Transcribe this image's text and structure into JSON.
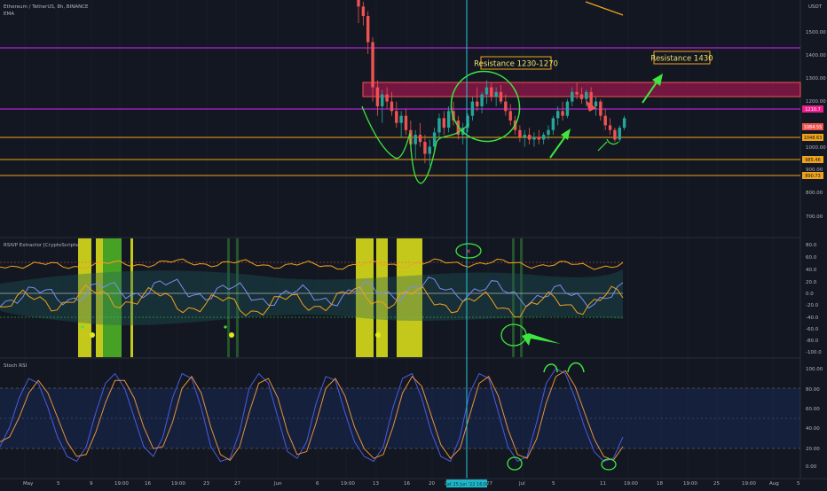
{
  "header": {
    "symbol_line": "Ethereum / TetherUS, 8h, BINANCE",
    "ema_label": "EMA",
    "quote_currency": "USDT"
  },
  "colors": {
    "background": "#131722",
    "grid": "#1e2230",
    "up": "#26a69a",
    "down": "#ef5350",
    "magenta": "#b321d6",
    "orange": "#f0a31a",
    "green_annot": "#3ee63e",
    "resistance_zone": "#c2185b",
    "cyan": "#29c4d6",
    "blue_line": "#5b6fd9",
    "stoch_k": "#4a5be0",
    "stoch_d": "#e8913a",
    "yellow_bar": "#e4e81a",
    "green_bar": "#55c425"
  },
  "annotations": {
    "res1": "Resistance 1230-1270",
    "res2": "Resistance 1430"
  },
  "price_axis": {
    "labels": [
      "1500.00",
      "1400.00",
      "1300.00",
      "1200.00",
      "1000.00",
      "900.00",
      "800.00",
      "700.00"
    ],
    "tags": [
      "1210.7",
      "1084.55",
      "1048.63",
      "985.46",
      "890.73"
    ]
  },
  "rsivp": {
    "title": "RSIVP Extractor [CryptoScripts]",
    "labels": [
      "80.0",
      "60.0",
      "40.0",
      "20.0",
      "0.0",
      "-20.0",
      "-40.0",
      "-60.0",
      "-80.0",
      "-100.0"
    ]
  },
  "stoch": {
    "title": "Stoch RSI",
    "labels": [
      "100.00",
      "80.00",
      "60.00",
      "40.00",
      "20.00",
      "0.00"
    ]
  },
  "time_axis": {
    "labels": [
      "May",
      "5",
      "9",
      "19:00",
      "16",
      "19:00",
      "23",
      "27",
      "Jun",
      "6",
      "19:00",
      "13",
      "16",
      "20",
      "23",
      "27",
      "Jul",
      "5",
      "11",
      "19:00",
      "18",
      "19:00",
      "25",
      "19:00",
      "Aug",
      "5"
    ],
    "cursor_date": "Sat 25 Jun '22 16:00"
  },
  "chart_data": {
    "type": "candlestick",
    "title": "Ethereum / TetherUS, 8h, BINANCE",
    "ylim": [
      650,
      1620
    ],
    "price_levels": [
      1450,
      1212,
      1047,
      988,
      890
    ],
    "resistance_zone": [
      1230,
      1290
    ],
    "candles_ohlc": [
      [
        1660,
        1700,
        1530,
        1600
      ],
      [
        1600,
        1620,
        1520,
        1560
      ],
      [
        1560,
        1580,
        1400,
        1450
      ],
      [
        1450,
        1470,
        1200,
        1260
      ],
      [
        1260,
        1290,
        1140,
        1180
      ],
      [
        1180,
        1250,
        1110,
        1230
      ],
      [
        1230,
        1260,
        1170,
        1200
      ],
      [
        1200,
        1240,
        1140,
        1160
      ],
      [
        1160,
        1200,
        1090,
        1110
      ],
      [
        1110,
        1160,
        1050,
        1140
      ],
      [
        1140,
        1170,
        1060,
        1080
      ],
      [
        1080,
        1120,
        990,
        1020
      ],
      [
        1020,
        1080,
        960,
        1060
      ],
      [
        1060,
        1110,
        1010,
        1030
      ],
      [
        1030,
        1060,
        940,
        980
      ],
      [
        980,
        1040,
        930,
        1010
      ],
      [
        1010,
        1090,
        990,
        1070
      ],
      [
        1070,
        1150,
        1050,
        1130
      ],
      [
        1130,
        1160,
        1060,
        1090
      ],
      [
        1090,
        1180,
        1070,
        1160
      ],
      [
        1160,
        1200,
        1100,
        1120
      ],
      [
        1120,
        1140,
        1040,
        1060
      ],
      [
        1060,
        1110,
        1020,
        1090
      ],
      [
        1090,
        1150,
        1070,
        1140
      ],
      [
        1140,
        1220,
        1120,
        1200
      ],
      [
        1200,
        1260,
        1160,
        1180
      ],
      [
        1180,
        1240,
        1150,
        1230
      ],
      [
        1230,
        1290,
        1190,
        1260
      ],
      [
        1260,
        1280,
        1200,
        1220
      ],
      [
        1220,
        1260,
        1180,
        1240
      ],
      [
        1240,
        1270,
        1190,
        1200
      ],
      [
        1200,
        1230,
        1140,
        1160
      ],
      [
        1160,
        1190,
        1100,
        1120
      ],
      [
        1120,
        1140,
        1060,
        1080
      ],
      [
        1080,
        1100,
        1030,
        1050
      ],
      [
        1050,
        1080,
        1010,
        1060
      ],
      [
        1060,
        1090,
        1020,
        1040
      ],
      [
        1040,
        1070,
        1010,
        1050
      ],
      [
        1050,
        1080,
        1020,
        1040
      ],
      [
        1040,
        1070,
        1020,
        1060
      ],
      [
        1060,
        1100,
        1040,
        1080
      ],
      [
        1080,
        1140,
        1060,
        1130
      ],
      [
        1130,
        1180,
        1100,
        1160
      ],
      [
        1160,
        1200,
        1120,
        1140
      ],
      [
        1140,
        1210,
        1130,
        1200
      ],
      [
        1200,
        1260,
        1180,
        1240
      ],
      [
        1240,
        1280,
        1210,
        1230
      ],
      [
        1230,
        1260,
        1190,
        1210
      ],
      [
        1210,
        1250,
        1180,
        1240
      ],
      [
        1240,
        1260,
        1170,
        1180
      ],
      [
        1180,
        1220,
        1140,
        1200
      ],
      [
        1200,
        1210,
        1120,
        1140
      ],
      [
        1140,
        1170,
        1080,
        1100
      ],
      [
        1100,
        1130,
        1060,
        1080
      ],
      [
        1080,
        1090,
        1030,
        1040
      ],
      [
        1040,
        1100,
        1030,
        1090
      ],
      [
        1090,
        1140,
        1080,
        1130
      ]
    ],
    "stoch_k": [
      20,
      40,
      70,
      90,
      85,
      60,
      30,
      10,
      5,
      20,
      55,
      85,
      95,
      80,
      50,
      20,
      10,
      30,
      70,
      95,
      90,
      60,
      20,
      5,
      8,
      35,
      80,
      95,
      85,
      50,
      15,
      8,
      25,
      65,
      92,
      88,
      55,
      25,
      10,
      5,
      20,
      60,
      90,
      95,
      70,
      35,
      10,
      5,
      30,
      75,
      95,
      90,
      55,
      20,
      5,
      10,
      45,
      85,
      100,
      95,
      70,
      40,
      15,
      5,
      8,
      30
    ],
    "stoch_d": [
      25,
      30,
      50,
      75,
      88,
      75,
      50,
      25,
      10,
      12,
      35,
      65,
      88,
      88,
      70,
      40,
      18,
      20,
      45,
      80,
      92,
      75,
      40,
      12,
      6,
      20,
      55,
      85,
      90,
      70,
      35,
      12,
      15,
      45,
      80,
      90,
      72,
      40,
      18,
      8,
      12,
      40,
      75,
      92,
      82,
      52,
      22,
      8,
      18,
      52,
      85,
      92,
      72,
      38,
      12,
      8,
      28,
      65,
      92,
      98,
      82,
      55,
      28,
      10,
      6,
      20
    ]
  }
}
